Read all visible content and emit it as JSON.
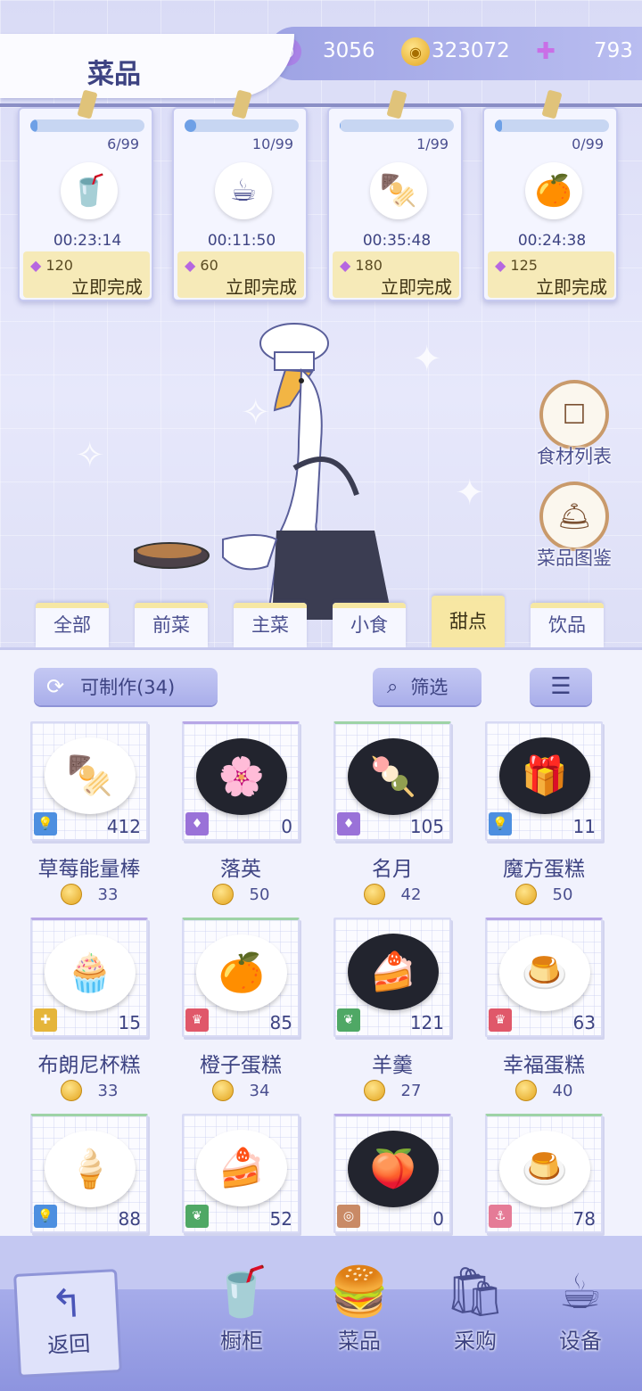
{
  "header": {
    "title": "菜品",
    "currencies": [
      {
        "icon": "purple-token-icon",
        "value": "3056"
      },
      {
        "icon": "gold-coin-icon",
        "value": "323072"
      },
      {
        "icon": "crystal-plus-icon",
        "value": "793"
      }
    ]
  },
  "production": [
    {
      "count": "6/99",
      "progress": 0.06,
      "time": "00:23:14",
      "cost": "120",
      "action": "立即完成",
      "dish_icon": "juice-glass-icon",
      "emoji": "🥤"
    },
    {
      "count": "10/99",
      "progress": 0.1,
      "time": "00:11:50",
      "cost": "60",
      "action": "立即完成",
      "dish_icon": "coffee-cup-icon",
      "emoji": "☕"
    },
    {
      "count": "1/99",
      "progress": 0.01,
      "time": "00:35:48",
      "cost": "180",
      "action": "立即完成",
      "dish_icon": "strawberry-skewer-icon",
      "emoji": "🍢"
    },
    {
      "count": "0/99",
      "progress": 0.0,
      "time": "00:24:38",
      "cost": "125",
      "action": "立即完成",
      "dish_icon": "orange-cake-icon",
      "emoji": "🍊"
    }
  ],
  "side_buttons": [
    {
      "label": "食材列表",
      "icon": "box-icon"
    },
    {
      "label": "菜品图鉴",
      "icon": "cloche-book-icon"
    }
  ],
  "tabs": [
    "全部",
    "前菜",
    "主菜",
    "小食",
    "甜点",
    "饮品"
  ],
  "active_tab": "甜点",
  "toolbar": {
    "craftable_label": "可制作(34)",
    "filter_label": "筛选"
  },
  "items": [
    {
      "name": "草莓能量棒",
      "price": "33",
      "qty": "412",
      "emoji": "🍢",
      "badge": "bulb",
      "badge_color": "#4d8fe0",
      "badge_glyph": "💡",
      "dark": false
    },
    {
      "name": "落英",
      "price": "50",
      "qty": "0",
      "emoji": "🌸",
      "badge": "diamond",
      "badge_color": "#9a72d8",
      "badge_glyph": "♦",
      "dark": true
    },
    {
      "name": "名月",
      "price": "42",
      "qty": "105",
      "emoji": "🍡",
      "badge": "diamond",
      "badge_color": "#9a72d8",
      "badge_glyph": "♦",
      "dark": true
    },
    {
      "name": "魔方蛋糕",
      "price": "50",
      "qty": "11",
      "emoji": "🎁",
      "badge": "bulb",
      "badge_color": "#4d8fe0",
      "badge_glyph": "💡",
      "dark": true
    },
    {
      "name": "布朗尼杯糕",
      "price": "33",
      "qty": "15",
      "emoji": "🧁",
      "badge": "puzzle",
      "badge_color": "#e5b53a",
      "badge_glyph": "✚",
      "dark": false
    },
    {
      "name": "橙子蛋糕",
      "price": "34",
      "qty": "85",
      "emoji": "🍊",
      "badge": "crown",
      "badge_color": "#e0586a",
      "badge_glyph": "♛",
      "dark": false
    },
    {
      "name": "羊羹",
      "price": "27",
      "qty": "121",
      "emoji": "🍰",
      "badge": "leaf",
      "badge_color": "#4fa865",
      "badge_glyph": "❦",
      "dark": true
    },
    {
      "name": "幸福蛋糕",
      "price": "40",
      "qty": "63",
      "emoji": "🍮",
      "badge": "crown",
      "badge_color": "#e0586a",
      "badge_glyph": "♛",
      "dark": false
    },
    {
      "name": "",
      "price": "",
      "qty": "88",
      "emoji": "🍦",
      "badge": "bulb",
      "badge_color": "#4d8fe0",
      "badge_glyph": "💡",
      "dark": false
    },
    {
      "name": "",
      "price": "",
      "qty": "52",
      "emoji": "🍰",
      "badge": "leaf",
      "badge_color": "#4fa865",
      "badge_glyph": "❦",
      "dark": false
    },
    {
      "name": "",
      "price": "",
      "qty": "0",
      "emoji": "🍑",
      "badge": "shell",
      "badge_color": "#c98a66",
      "badge_glyph": "◎",
      "dark": true
    },
    {
      "name": "",
      "price": "",
      "qty": "78",
      "emoji": "🍮",
      "badge": "anchor",
      "badge_color": "#e57b97",
      "badge_glyph": "⚓",
      "dark": false
    }
  ],
  "bottom_nav": {
    "back_label": "返回",
    "items": [
      {
        "label": "橱柜",
        "icon": "cabinet-drink-icon",
        "emoji": "🥤"
      },
      {
        "label": "菜品",
        "icon": "burger-icon",
        "emoji": "🍔"
      },
      {
        "label": "采购",
        "icon": "shopping-bag-icon",
        "emoji": "🛍"
      },
      {
        "label": "设备",
        "icon": "coffee-machine-icon",
        "emoji": "☕"
      }
    ]
  }
}
